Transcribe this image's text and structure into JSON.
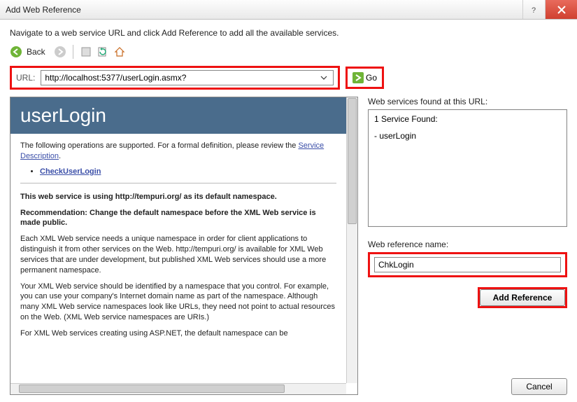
{
  "title": "Add Web Reference",
  "instruction": "Navigate to a web service URL and click Add Reference to add all the available services.",
  "nav": {
    "back": "Back",
    "go": "Go"
  },
  "url": {
    "label": "URL:",
    "value": "http://localhost:5377/userLogin.asmx?"
  },
  "preview": {
    "heading": "userLogin",
    "intro_a": "The following operations are supported. For a formal definition, please review the ",
    "service_desc_link": "Service Description",
    "operation_link": "CheckUserLogin",
    "ns_line": "This web service is using http://tempuri.org/ as its default namespace.",
    "rec_line": "Recommendation: Change the default namespace before the XML Web service is made public.",
    "p1": "Each XML Web service needs a unique namespace in order for client applications to distinguish it from other services on the Web. http://tempuri.org/ is available for XML Web services that are under development, but published XML Web services should use a more permanent namespace.",
    "p2": "Your XML Web service should be identified by a namespace that you control. For example, you can use your company's Internet domain name as part of the namespace. Although many XML Web service namespaces look like URLs, they need not point to actual resources on the Web. (XML Web service namespaces are URIs.)",
    "p3": "For XML Web services creating using ASP.NET, the default namespace can be"
  },
  "right": {
    "found_label": "Web services found at this URL:",
    "found_header": "1 Service Found:",
    "service_item": "- userLogin",
    "refname_label": "Web reference name:",
    "refname_value": "ChkLogin",
    "addref": "Add Reference",
    "cancel": "Cancel"
  }
}
